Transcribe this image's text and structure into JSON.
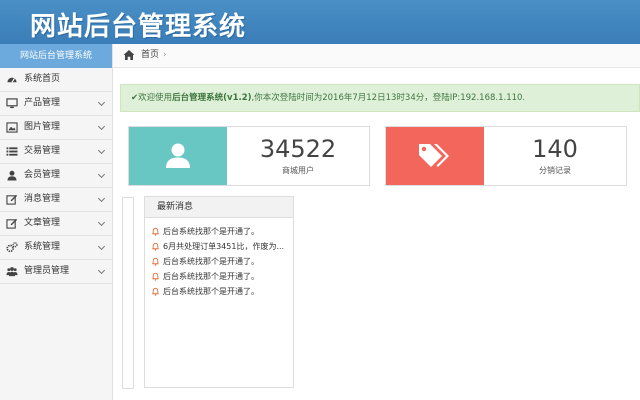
{
  "header": {
    "title": "网站后台管理系统"
  },
  "sidebar": {
    "title": "网站后台管理系统",
    "items": [
      {
        "label": "系统首页",
        "icon": "dashboard-icon",
        "chevron": false
      },
      {
        "label": "产品管理",
        "icon": "monitor-icon",
        "chevron": true
      },
      {
        "label": "图片管理",
        "icon": "image-icon",
        "chevron": true
      },
      {
        "label": "交易管理",
        "icon": "list-icon",
        "chevron": true
      },
      {
        "label": "会员管理",
        "icon": "user-icon",
        "chevron": true
      },
      {
        "label": "消息管理",
        "icon": "edit-icon",
        "chevron": true
      },
      {
        "label": "文章管理",
        "icon": "edit-icon",
        "chevron": true
      },
      {
        "label": "系统管理",
        "icon": "gears-icon",
        "chevron": true
      },
      {
        "label": "管理员管理",
        "icon": "users-icon",
        "chevron": true
      }
    ]
  },
  "breadcrumb": {
    "home": "首页",
    "separator": "›"
  },
  "alert": {
    "prefix": "欢迎使用",
    "system": "后台管理系统",
    "version": "(v1.2)",
    "mid": ",你本次登陆时间为",
    "time": "2016年7月12日13时34分",
    "ip_label": "，登陆IP:",
    "ip": "192.168.1.110."
  },
  "stats": [
    {
      "value": "34522",
      "label": "商城用户",
      "color": "#68c7c2",
      "icon": "user-icon"
    },
    {
      "value": "140",
      "label": "分销记录",
      "color": "#f2665c",
      "icon": "tags-icon"
    }
  ],
  "messages": {
    "title": "最新消息",
    "items": [
      "后台系统找那个是开通了。",
      "6月共处理订单3451比，作废为...",
      "后台系统找那个是开通了。",
      "后台系统找那个是开通了。",
      "后台系统找那个是开通了。"
    ]
  }
}
